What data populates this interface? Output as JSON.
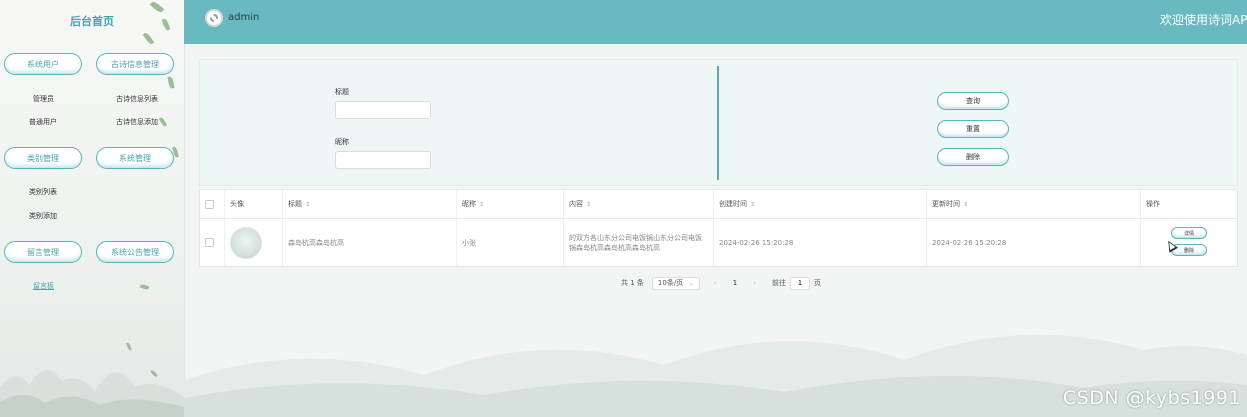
{
  "sidebar": {
    "title": "后台首页",
    "groups": [
      {
        "label": "系统用户",
        "items": [
          "管理员",
          "普通用户"
        ]
      },
      {
        "label": "古诗信息管理",
        "items": [
          "古诗信息列表",
          "古诗信息添加"
        ]
      },
      {
        "label": "类别管理",
        "items": [
          "类别列表",
          "类别添加"
        ]
      },
      {
        "label": "系统管理",
        "items": []
      },
      {
        "label": "留言管理",
        "items": [
          "留言板"
        ]
      },
      {
        "label": "系统公告管理",
        "items": []
      }
    ]
  },
  "header": {
    "user": "admin",
    "welcome": "欢迎使用诗词API"
  },
  "search": {
    "title_label": "标题",
    "title_value": "",
    "nickname_label": "昵称",
    "nickname_value": "",
    "query_button": "查询",
    "reset_button": "重置",
    "delete_button": "删除"
  },
  "table": {
    "columns": [
      "头像",
      "标题",
      "昵称",
      "内容",
      "创建时间",
      "更新时间",
      "操作"
    ],
    "rows": [
      {
        "title": "森岛杭高森岛杭高",
        "nickname": "小张",
        "content": "的双方各山东分公司电饭锅山东分公司电饭锅森岛杭高森岛杭高森岛杭高",
        "created": "2024-02-26 15:20:28",
        "updated": "2024-02-26 15:20:28",
        "actions": [
          "详情",
          "删除"
        ]
      }
    ]
  },
  "pagination": {
    "total": "共 1 条",
    "page_size": "10条/页",
    "current": "1",
    "goto_label": "前往",
    "goto_value": "1",
    "page_suffix": "页"
  },
  "watermark": "CSDN @kybs1991",
  "colors": {
    "accent": "#69b9c0",
    "border": "#5ab4bc"
  }
}
